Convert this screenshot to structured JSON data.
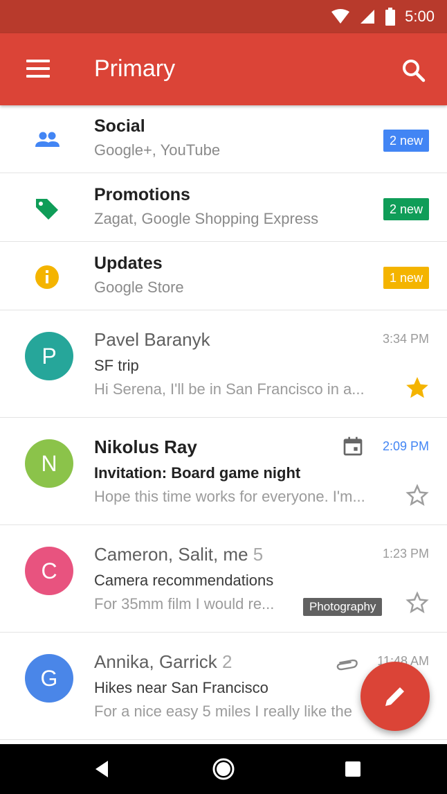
{
  "status_bar": {
    "time": "5:00"
  },
  "app_bar": {
    "title": "Primary"
  },
  "categories": [
    {
      "title": "Social",
      "subtitle": "Google+, YouTube",
      "badge": "2 new",
      "color": "#4285f4"
    },
    {
      "title": "Promotions",
      "subtitle": "Zagat, Google Shopping Express",
      "badge": "2 new",
      "color": "#0f9d58"
    },
    {
      "title": "Updates",
      "subtitle": "Google Store",
      "badge": "1 new",
      "color": "#f4b400"
    }
  ],
  "emails": [
    {
      "initial": "P",
      "avatar_color": "#26a69a",
      "sender": "Pavel Baranyk",
      "count": "",
      "time": "3:34 PM",
      "subject": "SF trip",
      "snippet": "Hi Serena, I'll be in San Francisco in a...",
      "starred": true
    },
    {
      "initial": "N",
      "avatar_color": "#8bc34a",
      "sender": "Nikolus Ray",
      "count": "",
      "time": "2:09 PM",
      "subject": "Invitation: Board game night",
      "snippet": "Hope this time works for everyone. I'm...",
      "starred": false,
      "icon": "calendar-icon"
    },
    {
      "initial": "C",
      "avatar_color": "#e8537f",
      "sender": "Cameron, Salit, me",
      "count": "5",
      "time": "1:23 PM",
      "subject": "Camera recommendations",
      "snippet": "For 35mm film I would re...",
      "label": "Photography",
      "starred": false
    },
    {
      "initial": "G",
      "avatar_color": "#4a86e8",
      "sender": "Annika, Garrick",
      "count": "2",
      "time": "11:48 AM",
      "subject": "Hikes near San Francisco",
      "snippet": "For a nice easy 5 miles I really like the",
      "starred": false,
      "icon": "attachment-icon"
    }
  ],
  "colors": {
    "primary": "#db4437",
    "status_bar": "#b83a2c",
    "unread_time": "#4285f4",
    "star": "#f4b400"
  }
}
